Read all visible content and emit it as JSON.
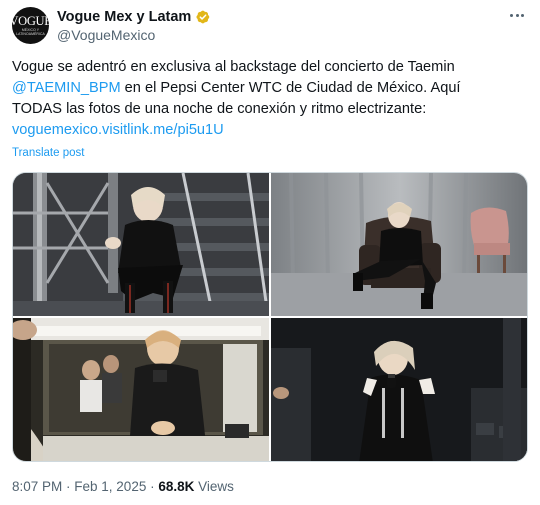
{
  "author": {
    "display_name": "Vogue Mex y Latam",
    "handle": "@VogueMexico",
    "avatar_logo": "VOGUE",
    "avatar_subtext": "MÉXICO Y LATINOAMÉRICA",
    "verified_badge": "verified-gold-icon",
    "badge_color": "#e2b719"
  },
  "tweet": {
    "line1": "Vogue se adentró en exclusiva al backstage del concierto de Taemin",
    "mention": "@TAEMIN_BPM",
    "line2_rest": " en el Pepsi Center WTC de Ciudad de México. Aquí",
    "line3": "TODAS las fotos de una noche de conexión y ritmo electrizante:",
    "link": "voguemexico.visitlink.me/pi5u1U",
    "translate": "Translate post"
  },
  "media": {
    "photos": [
      {
        "name": "photo-stairs",
        "icon": "photo"
      },
      {
        "name": "photo-armchair",
        "icon": "photo"
      },
      {
        "name": "photo-mirror",
        "icon": "photo"
      },
      {
        "name": "photo-backstage",
        "icon": "photo"
      }
    ]
  },
  "meta": {
    "time": "8:07 PM",
    "separator": " · ",
    "date": "Feb 1, 2025",
    "views_count": "68.8K",
    "views_label": " Views"
  },
  "colors": {
    "link": "#1d9bf0",
    "secondary_text": "#536471",
    "primary_text": "#0f1419"
  }
}
